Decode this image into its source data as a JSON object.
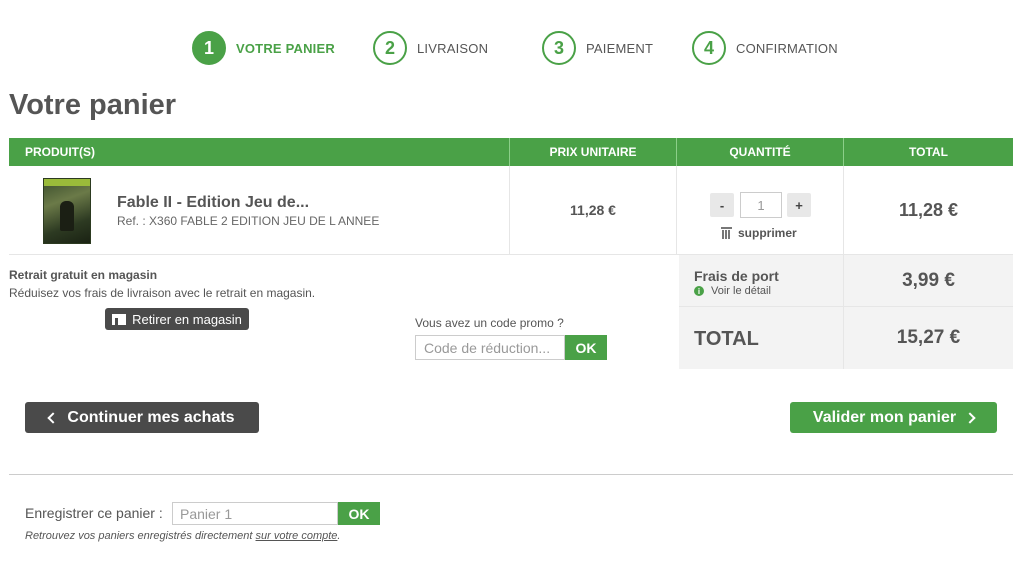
{
  "steps": [
    {
      "num": "1",
      "label": "VOTRE PANIER"
    },
    {
      "num": "2",
      "label": "LIVRAISON"
    },
    {
      "num": "3",
      "label": "PAIEMENT"
    },
    {
      "num": "4",
      "label": "CONFIRMATION"
    }
  ],
  "page_title": "Votre panier",
  "table": {
    "headers": [
      "PRODUIT(S)",
      "PRIX UNITAIRE",
      "QUANTITÉ",
      "TOTAL"
    ],
    "row": {
      "name": "Fable II - Edition Jeu de...",
      "ref": "Ref. : X360 FABLE 2 EDITION JEU DE L ANNEE",
      "unit_price": "11,28 €",
      "qty_minus": "-",
      "qty_value": "1",
      "qty_plus": "+",
      "remove_label": "supprimer",
      "total": "11,28 €"
    }
  },
  "retrait": {
    "title": "Retrait gratuit en magasin",
    "desc": "Réduisez vos frais de livraison avec le retrait en magasin.",
    "button": "Retirer en magasin"
  },
  "promo": {
    "question": "Vous avez un code promo ?",
    "placeholder": "Code de réduction...",
    "ok": "OK"
  },
  "summary": {
    "shipping_label": "Frais de port",
    "shipping_detail": "Voir le détail",
    "shipping_value": "3,99 €",
    "total_label": "TOTAL",
    "total_value": "15,27 €"
  },
  "actions": {
    "continue": "Continuer mes achats",
    "validate": "Valider mon panier"
  },
  "save": {
    "label": "Enregistrer ce panier :",
    "placeholder": "Panier 1",
    "ok": "OK",
    "note_prefix": "Retrouvez vos paniers enregistrés directement ",
    "note_link": "sur votre compte",
    "note_suffix": "."
  },
  "colors": {
    "accent": "#4aa147",
    "dark": "#4a4a4a",
    "text": "#555555"
  }
}
